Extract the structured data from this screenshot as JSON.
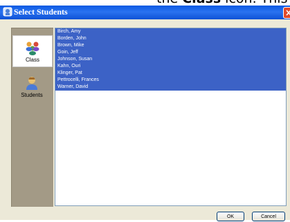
{
  "caption": {
    "text_before": "the ",
    "bold": "Class",
    "text_after": " icon.  This is shown below"
  },
  "window": {
    "title": "Select Students",
    "close_icon": "close-icon"
  },
  "sidebar": {
    "items": [
      {
        "label": "Class",
        "icon": "class-group-icon",
        "selected": true
      },
      {
        "label": "Students",
        "icon": "student-person-icon",
        "selected": false
      }
    ]
  },
  "students": [
    "Birch, Amy",
    "Borden, John",
    "Brown, Mike",
    "Goin, Jeff",
    "Johnson, Susan",
    "Kahn, Ouri",
    "Klinger, Pat",
    "Pettrocelli, Frances",
    "Warner, David"
  ],
  "buttons": {
    "ok": "OK",
    "cancel": "Cancel"
  },
  "colors": {
    "titlebar": "#0a5ae3",
    "selection": "#3c62c6",
    "sidebar": "#a39a86",
    "dialog": "#ece9d8"
  }
}
